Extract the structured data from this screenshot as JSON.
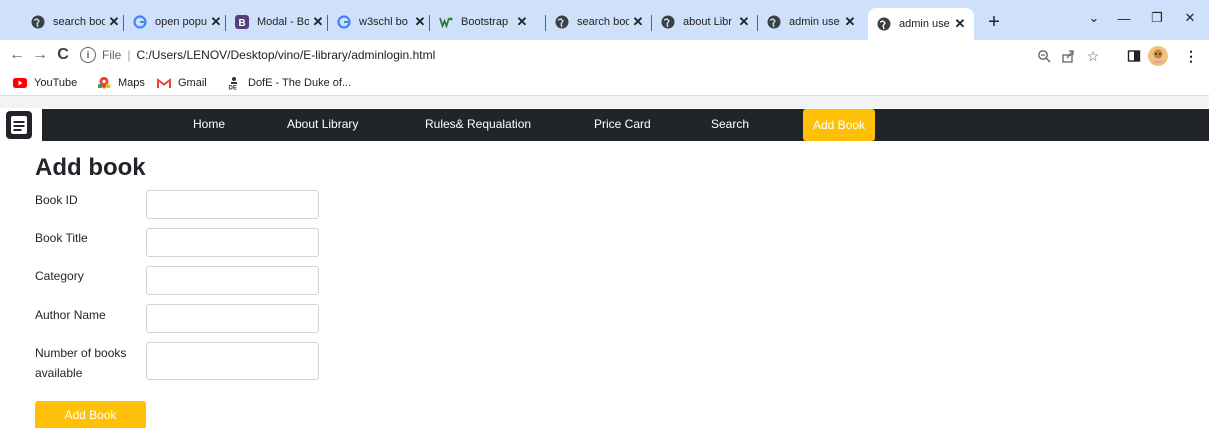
{
  "browser": {
    "tabs": [
      {
        "title": "search boo",
        "icon": "globe-icon"
      },
      {
        "title": "open popu",
        "icon": "google-icon"
      },
      {
        "title": "Modal - Bo",
        "icon": "bootstrap-icon"
      },
      {
        "title": "w3schl bo",
        "icon": "google-icon"
      },
      {
        "title": "Bootstrap",
        "icon": "w3schools-icon"
      },
      {
        "title": "search boo",
        "icon": "globe-icon"
      },
      {
        "title": "about Libr",
        "icon": "globe-icon"
      },
      {
        "title": "admin use",
        "icon": "globe-icon"
      },
      {
        "title": "admin use",
        "icon": "globe-icon"
      }
    ],
    "address": {
      "scheme": "File",
      "url": "C:/Users/LENOV/Desktop/vino/E-library/adminlogin.html"
    },
    "bookmarks": [
      {
        "label": "YouTube",
        "icon": "youtube-icon"
      },
      {
        "label": "Maps",
        "icon": "maps-icon"
      },
      {
        "label": "Gmail",
        "icon": "gmail-icon"
      },
      {
        "label": "DofE - The Duke of...",
        "icon": "dofe-icon"
      }
    ]
  },
  "navbar": {
    "links": [
      "Home",
      "About Library",
      "Rules& Requalation",
      "Price Card",
      "Search"
    ],
    "active_link": "Add Book"
  },
  "form": {
    "title": "Add book",
    "fields": [
      {
        "label": "Book ID",
        "value": ""
      },
      {
        "label": "Book Title",
        "value": ""
      },
      {
        "label": "Category",
        "value": ""
      },
      {
        "label": "Author Name",
        "value": ""
      },
      {
        "label": "Number of books available",
        "value": ""
      }
    ],
    "submit_label": "Add Book"
  },
  "colors": {
    "tab_strip": "#cfe0fb",
    "navbar": "#212529",
    "accent": "#ffc107"
  }
}
